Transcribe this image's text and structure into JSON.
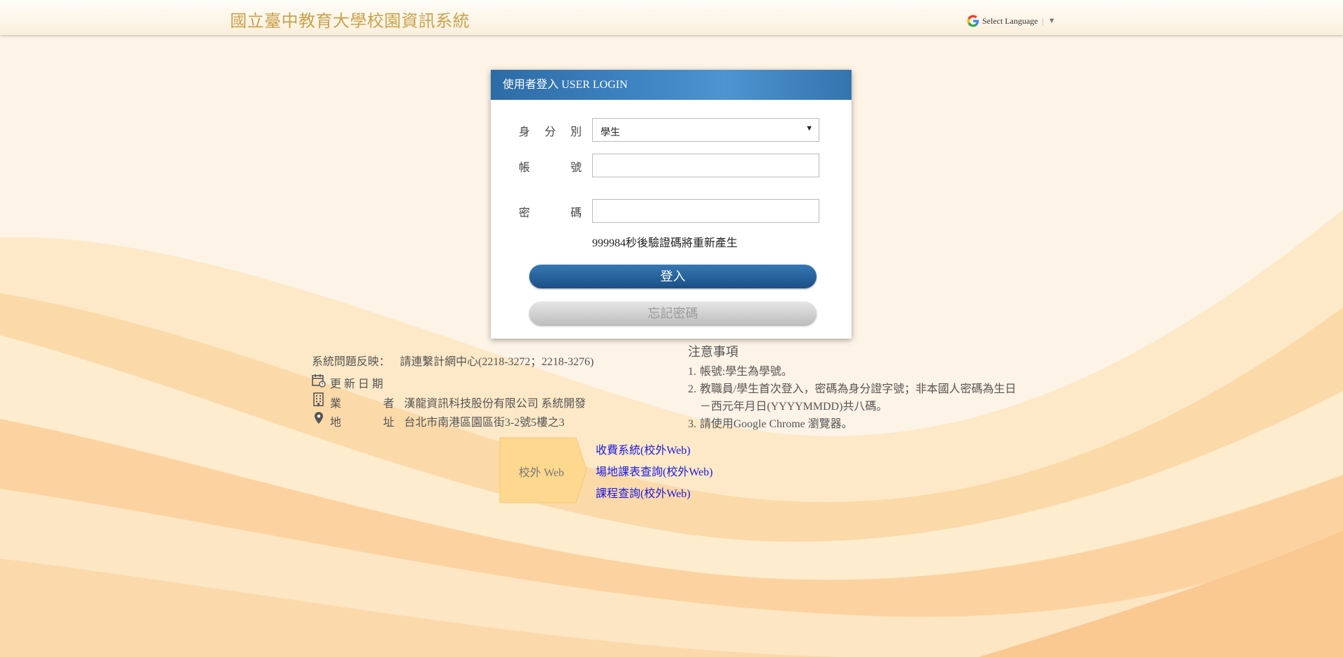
{
  "header": {
    "site_title": "國立臺中教育大學校園資訊系統",
    "language_label": "Select Language",
    "language_separator": "|",
    "language_caret": "▼"
  },
  "login": {
    "heading": "使用者登入 USER LOGIN",
    "identity_label": [
      "身",
      "分",
      "別"
    ],
    "identity_value": "學生",
    "account_label": [
      "帳",
      "號"
    ],
    "account_value": "",
    "password_label": [
      "密",
      "碼"
    ],
    "password_value": "",
    "countdown_text": "999984秒後驗證碼將重新產生",
    "login_button": "登入",
    "forgot_button": "忘記密碼"
  },
  "info": {
    "contact_label": "系統問題反映：",
    "contact_value": "請連繫計網中心(2218-3272；2218-3276)",
    "update_label": "更 新 日 期",
    "update_value": "",
    "developer_label_a": "業",
    "developer_label_b": "者",
    "developer_value": "漢龍資訊科技股份有限公司 系統開發",
    "address_label_a": "地",
    "address_label_b": "址",
    "address_value": "台北市南港區園區街3-2號5樓之3"
  },
  "notice": {
    "title": "注意事項",
    "items": [
      {
        "num": "1.",
        "text": "帳號:學生為學號。"
      },
      {
        "num": "2.",
        "text": "教職員/學生首次登入，密碼為身分證字號；非本國人密碼為生日－西元年月日(YYYYMMDD)共八碼。"
      },
      {
        "num": "3.",
        "text": "請使用Google Chrome 瀏覽器。"
      }
    ]
  },
  "external": {
    "badge": "校外 Web",
    "links": [
      "收費系統(校外Web)",
      "場地課表查詢(校外Web)",
      "課程查詢(校外Web)"
    ]
  },
  "colors": {
    "background": "#fdf3e6",
    "title_gold": "#c9a24c",
    "login_header_blue": "#3e83c2",
    "login_button_blue": "#1b4f86",
    "link_blue": "#1a1ae0"
  }
}
